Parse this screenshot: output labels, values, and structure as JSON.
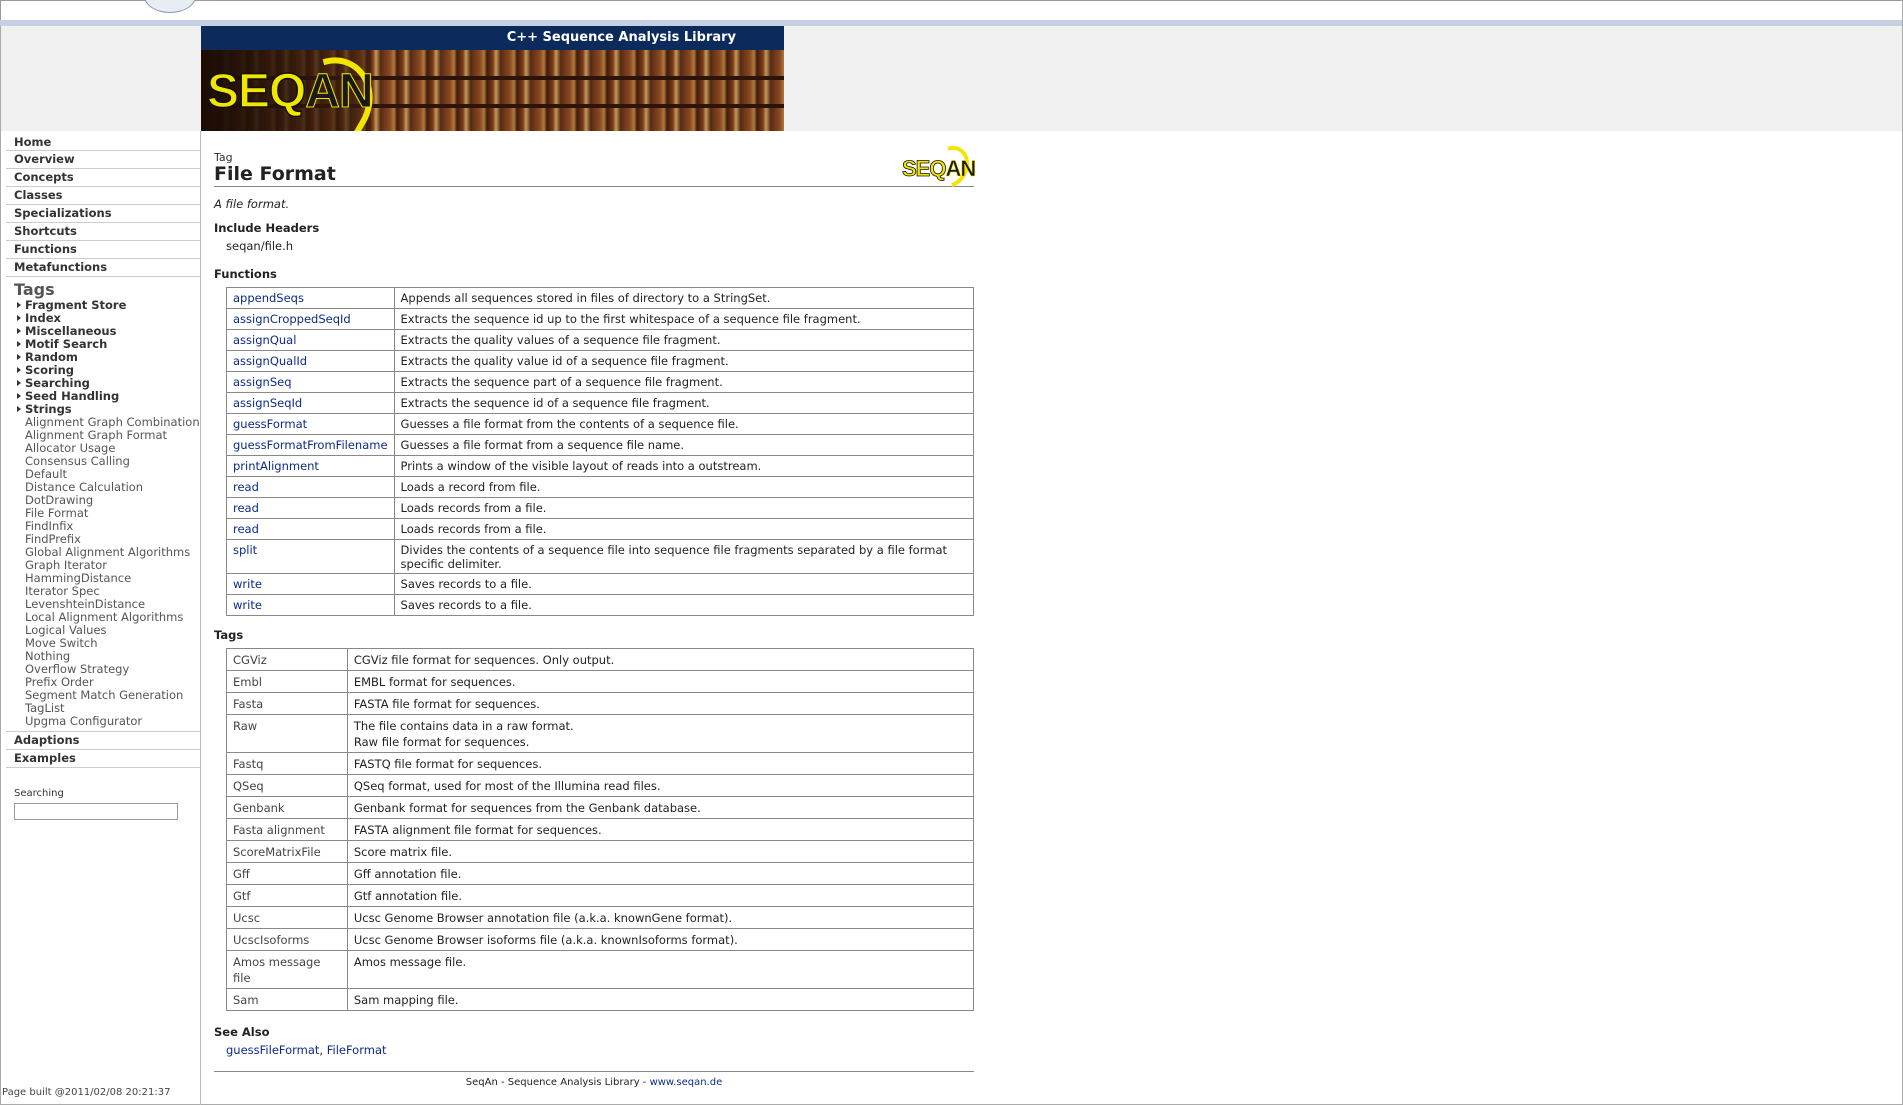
{
  "banner": {
    "title": "C++ Sequence Analysis Library",
    "logo_seq": "SEQ",
    "logo_an": "AN"
  },
  "nav": {
    "top_items": [
      "Home",
      "Overview",
      "Concepts",
      "Classes",
      "Specializations",
      "Shortcuts",
      "Functions",
      "Metafunctions"
    ],
    "tags_heading": "Tags",
    "tag_categories": [
      "Fragment Store",
      "Index",
      "Miscellaneous",
      "Motif Search",
      "Random",
      "Scoring",
      "Searching",
      "Seed Handling",
      "Strings"
    ],
    "tag_links": [
      "Alignment Graph Combination",
      "Alignment Graph Format",
      "Allocator Usage",
      "Consensus Calling",
      "Default",
      "Distance Calculation",
      "DotDrawing",
      "File Format",
      "FindInfix",
      "FindPrefix",
      "Global Alignment Algorithms",
      "Graph Iterator",
      "HammingDistance",
      "Iterator Spec",
      "LevenshteinDistance",
      "Local Alignment Algorithms",
      "Logical Values",
      "Move Switch",
      "Nothing",
      "Overflow Strategy",
      "Prefix Order",
      "Segment Match Generation",
      "TagList",
      "Upgma Configurator"
    ],
    "bottom_items": [
      "Adaptions",
      "Examples"
    ],
    "search_label": "Searching",
    "search_value": ""
  },
  "main": {
    "kind": "Tag",
    "title": "File Format",
    "summary": "A file format.",
    "include_heading": "Include Headers",
    "include_header": "seqan/file.h",
    "functions_heading": "Functions",
    "functions": [
      {
        "name": "appendSeqs",
        "desc": "Appends all sequences stored in files of directory to a StringSet."
      },
      {
        "name": "assignCroppedSeqId",
        "desc": "Extracts the sequence id up to the first whitespace of a sequence file fragment."
      },
      {
        "name": "assignQual",
        "desc": "Extracts the quality values of a sequence file fragment."
      },
      {
        "name": "assignQualId",
        "desc": "Extracts the quality value id of a sequence file fragment."
      },
      {
        "name": "assignSeq",
        "desc": "Extracts the sequence part of a sequence file fragment."
      },
      {
        "name": "assignSeqId",
        "desc": "Extracts the sequence id of a sequence file fragment."
      },
      {
        "name": "guessFormat",
        "desc": "Guesses a file format from the contents of a sequence file."
      },
      {
        "name": "guessFormatFromFilename",
        "desc": "Guesses a file format from a sequence file name."
      },
      {
        "name": "printAlignment",
        "desc": "Prints a window of the visible layout of reads into a outstream."
      },
      {
        "name": "read",
        "desc": "Loads a record from file."
      },
      {
        "name": "read",
        "desc": "Loads records from a file."
      },
      {
        "name": "read",
        "desc": "Loads records from a file."
      },
      {
        "name": "split",
        "desc": "Divides the contents of a sequence file into sequence file fragments separated by a file format specific delimiter."
      },
      {
        "name": "write",
        "desc": "Saves records to a file."
      },
      {
        "name": "write",
        "desc": "Saves records to a file."
      }
    ],
    "tags_heading": "Tags",
    "tags": [
      {
        "name": "CGViz",
        "desc": [
          "CGViz file format for sequences. Only output."
        ]
      },
      {
        "name": "Embl",
        "desc": [
          "EMBL format for sequences."
        ]
      },
      {
        "name": "Fasta",
        "desc": [
          "FASTA file format for sequences."
        ]
      },
      {
        "name": "Raw",
        "desc": [
          "The file contains data in a raw format.",
          "Raw file format for sequences."
        ]
      },
      {
        "name": "Fastq",
        "desc": [
          "FASTQ file format for sequences."
        ]
      },
      {
        "name": "QSeq",
        "desc": [
          "QSeq format, used for most of the Illumina read files."
        ]
      },
      {
        "name": "Genbank",
        "desc": [
          "Genbank format for sequences from the Genbank database."
        ]
      },
      {
        "name": "Fasta alignment",
        "desc": [
          "FASTA alignment file format for sequences."
        ]
      },
      {
        "name": "ScoreMatrixFile",
        "desc": [
          "Score matrix file."
        ]
      },
      {
        "name": "Gff",
        "desc": [
          "Gff annotation file."
        ]
      },
      {
        "name": "Gtf",
        "desc": [
          "Gtf annotation file."
        ]
      },
      {
        "name": "Ucsc",
        "desc": [
          "Ucsc Genome Browser annotation file (a.k.a. knownGene format)."
        ]
      },
      {
        "name": "UcscIsoforms",
        "desc": [
          "Ucsc Genome Browser isoforms file (a.k.a. knownIsoforms format)."
        ]
      },
      {
        "name": "Amos message file",
        "desc": [
          "Amos message file."
        ]
      },
      {
        "name": "Sam",
        "desc": [
          "Sam mapping file."
        ]
      }
    ],
    "seealso_heading": "See Also",
    "seealso": [
      "guessFileFormat",
      "FileFormat"
    ],
    "seealso_sep": ", ",
    "footer_text": "SeqAn - Sequence Analysis Library - ",
    "footer_link": "www.seqan.de"
  },
  "built": "Page built @2011/02/08 20:21:37",
  "colors": {
    "link": "#0d2a8a",
    "banner_bar": "#0d2a5c",
    "logo_yellow": "#f2e600"
  }
}
